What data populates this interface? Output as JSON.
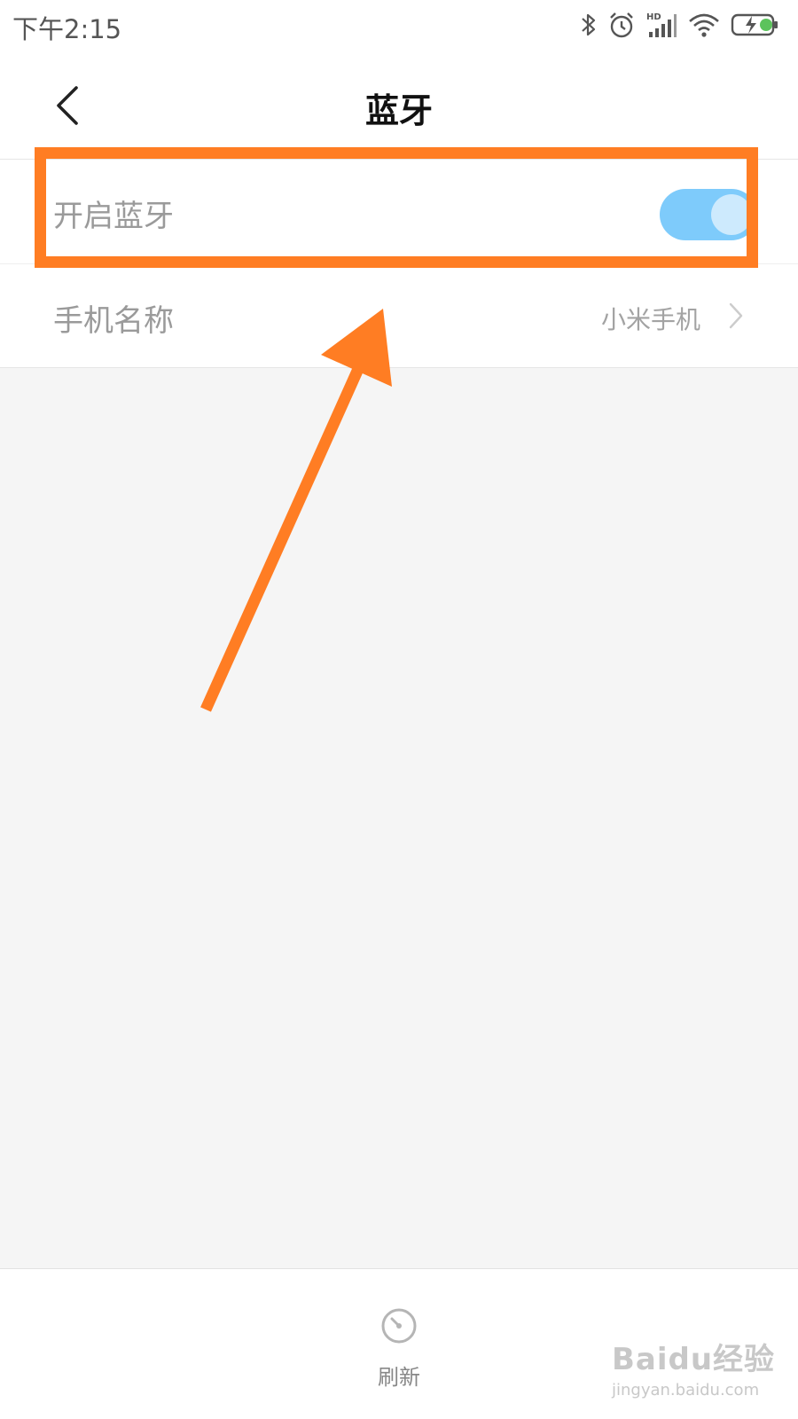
{
  "status_bar": {
    "time": "下午2:15",
    "icons": [
      "bluetooth-icon",
      "alarm-icon",
      "signal-hd-icon",
      "wifi-icon",
      "battery-charging-icon"
    ]
  },
  "header": {
    "title": "蓝牙",
    "back_icon": "chevron-left-icon"
  },
  "settings": {
    "bluetooth": {
      "label": "开启蓝牙",
      "enabled": true
    },
    "phone_name": {
      "label": "手机名称",
      "value": "小米手机"
    }
  },
  "bottom_bar": {
    "refresh_label": "刷新",
    "refresh_icon": "refresh-icon"
  },
  "watermark": {
    "logo_text": "Baidu经验",
    "url": "jingyan.baidu.com"
  },
  "colors": {
    "accent_orange": "#ff7d23",
    "toggle_on": "#7ecbfb",
    "toggle_knob": "#cdeafd",
    "background": "#f5f5f5"
  }
}
